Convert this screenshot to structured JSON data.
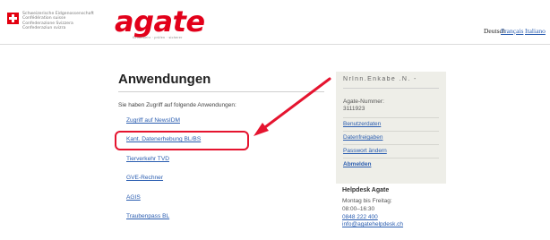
{
  "colors": {
    "brand": "#e2001a",
    "link": "#2a5db0",
    "annotation": "#e5142f",
    "sidebar_bg": "#eeeee8"
  },
  "header": {
    "confederation": [
      "Schweizerische Eidgenossenschaft",
      "Confédération suisse",
      "Confederazione Svizzera",
      "Confederaziun svizra"
    ],
    "logo": {
      "text": "agate",
      "tagline": "tierverkehr · prüfen · sicherer"
    },
    "languages": [
      "Deutsch",
      "Français",
      "Italiano"
    ]
  },
  "main": {
    "title": "Anwendungen",
    "intro": "Sie haben Zugriff auf folgende Anwendungen:",
    "apps": [
      "Zugriff auf NewsIDM",
      "Kant. Datenerhebung BL/BS",
      "Tierverkehr TVD",
      "GVE-Rechner",
      "AGIS",
      "Traubenpass BL"
    ]
  },
  "sidebar": {
    "user_name": "Nrlnn.Enkabe .N. -",
    "agate_number_label": "Agate-Nummer:",
    "agate_number": "3111923",
    "links": [
      "Benutzerdaten",
      "Datenfreigaben",
      "Passwort ändern"
    ],
    "logout": "Abmelden"
  },
  "helpdesk": {
    "title": "Helpdesk Agate",
    "hours_label": "Montag bis Freitag:",
    "hours": "08:00–16:30",
    "phone": "0848 222 400",
    "email": "info@agatehelpdesk.ch"
  }
}
